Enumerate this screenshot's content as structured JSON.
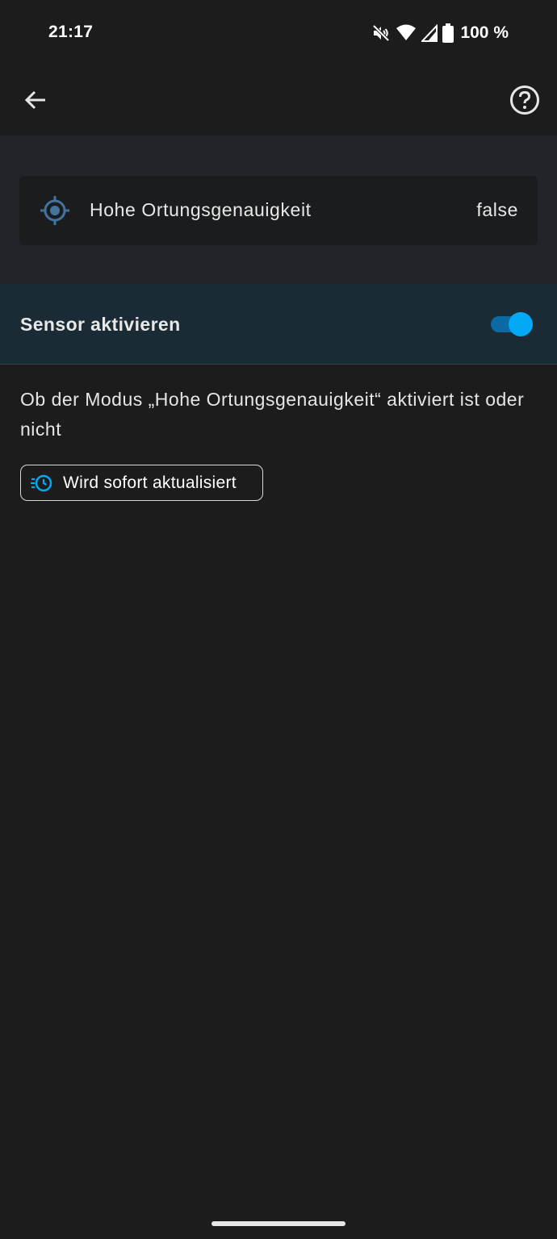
{
  "status_bar": {
    "time": "21:17",
    "battery": "100 %",
    "icons": [
      "mute-icon",
      "wifi-icon",
      "signal-icon",
      "battery-icon"
    ]
  },
  "app_bar": {
    "back_icon": "arrow-left-icon",
    "help_icon": "help-circle-icon"
  },
  "entity": {
    "icon": "crosshairs-gps-icon",
    "name": "Hohe Ortungsgenauigkeit",
    "state": "false"
  },
  "sensor_toggle": {
    "label": "Sensor aktivieren",
    "enabled": true,
    "accent_color": "#03a9f4"
  },
  "description": "Ob der Modus „Hohe Ortungsgenauigkeit“ aktiviert ist oder nicht",
  "update_chip": {
    "icon": "clock-fast-icon",
    "label": "Wird sofort aktualisiert"
  },
  "colors": {
    "background": "#1c1c1d",
    "header_panel": "#22242a",
    "toggle_row": "#1b2b36",
    "accent": "#03a9f4"
  }
}
